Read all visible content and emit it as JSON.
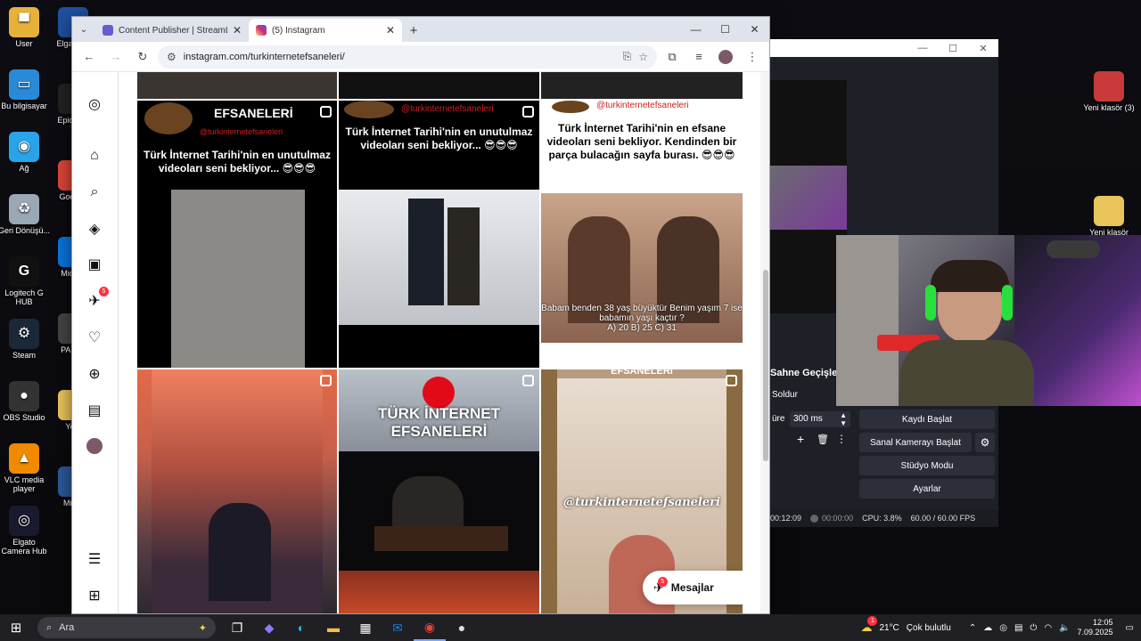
{
  "desktop": {
    "icons_left": [
      {
        "label": "User",
        "color": "#e8b23a",
        "glyph": "▀"
      },
      {
        "label": "Bu bilgisayar",
        "color": "#2a8ad8",
        "glyph": "▭"
      },
      {
        "label": "Ağ",
        "color": "#2aa4e8",
        "glyph": "◉"
      },
      {
        "label": "Geri Dönüşü...",
        "color": "#9aa7b4",
        "glyph": "♻"
      },
      {
        "label": "Logitech G HUB",
        "color": "#111111",
        "glyph": "G"
      },
      {
        "label": "Steam",
        "color": "#1b2838",
        "glyph": "⚙"
      },
      {
        "label": "OBS Studio",
        "color": "#333333",
        "glyph": "●"
      },
      {
        "label": "VLC media player",
        "color": "#f08a00",
        "glyph": "▲"
      },
      {
        "label": "Elgato Camera Hub",
        "color": "#1a1a2e",
        "glyph": "◎"
      }
    ],
    "icons_col2": [
      {
        "label": "Elga Cap",
        "color": "#2050a0"
      },
      {
        "label": "Epic Lau",
        "color": "#222222"
      },
      {
        "label": "Goo Ch",
        "color": "#db4437"
      },
      {
        "label": "Mic Ed",
        "color": "#0a74da"
      },
      {
        "label": "PA ANI",
        "color": "#444444"
      },
      {
        "label": "Yeni",
        "color": "#e8c45a"
      },
      {
        "label": "Micro",
        "color": "#2b579a"
      }
    ],
    "icons_right": [
      {
        "label": "Yeni klasör (3)",
        "color": "#c83a3a"
      },
      {
        "label": "Yeni klasör",
        "color": "#e8c45a"
      }
    ]
  },
  "browser": {
    "tabs": [
      {
        "title": "Content Publisher | StreamLad...",
        "active": false,
        "fav_color": "#6a5acd"
      },
      {
        "title": "(5) Instagram",
        "active": true,
        "fav_color": "#e1306c"
      }
    ],
    "url": "instagram.com/turkinternetefsaneleri/"
  },
  "instagram": {
    "nav_badge": "5",
    "posts": [
      {
        "caption": "Türk İnternet Tarihi'nin en unutulmaz videoları seni bekliyor... 😎😎😎",
        "header": "EFSANELERİ",
        "handle": "@turkinternetefsaneleri"
      },
      {
        "caption": "Türk İnternet Tarihi'nin en unutulmaz videoları seni bekliyor... 😎😎😎",
        "header": "",
        "handle": "@turkinternetefsaneleri"
      },
      {
        "caption": "Türk İnternet Tarihi'nin en efsane videoları seni bekliyor. Kendinden bir parça bulacağın sayfa burası. 😎😎😎",
        "header": "",
        "handle": "@turkinternetefsaneleri"
      },
      {
        "caption": "",
        "header": "",
        "handle": ""
      },
      {
        "caption": "TÜRK İNTERNET EFSANELERİ",
        "header": "",
        "handle": ""
      },
      {
        "caption": "@turkinternetefsaneleri",
        "header": "EFSANELERİ",
        "handle": ""
      }
    ],
    "quiz_line1": "Babam benden 38 yaş büyüktür Benim yaşım 7 ise",
    "quiz_line2": "babamın yaşı kaçtır ?",
    "quiz_options": "A) 20     B) 25     C) 31",
    "messages_label": "Mesajlar",
    "messages_badge": "5"
  },
  "obs": {
    "transitions_label": "Sahne Geçişleri",
    "transition_type": "Soldur",
    "duration_label": "üre",
    "duration_value": "300 ms",
    "buttons": [
      "Kaydı Başlat",
      "Sanal Kamerayı Başlat",
      "Stüdyo Modu",
      "Ayarlar"
    ],
    "status_time1": "00:12:09",
    "status_time2": "00:00:00",
    "cpu": "CPU: 3.8%",
    "fps": "60.00 / 60.00 FPS"
  },
  "taskbar": {
    "search_placeholder": "Ara",
    "weather_temp": "21°C",
    "weather_text": "Çok bulutlu",
    "weather_badge": "1",
    "time": "12:05",
    "date": "7.09.2025"
  }
}
